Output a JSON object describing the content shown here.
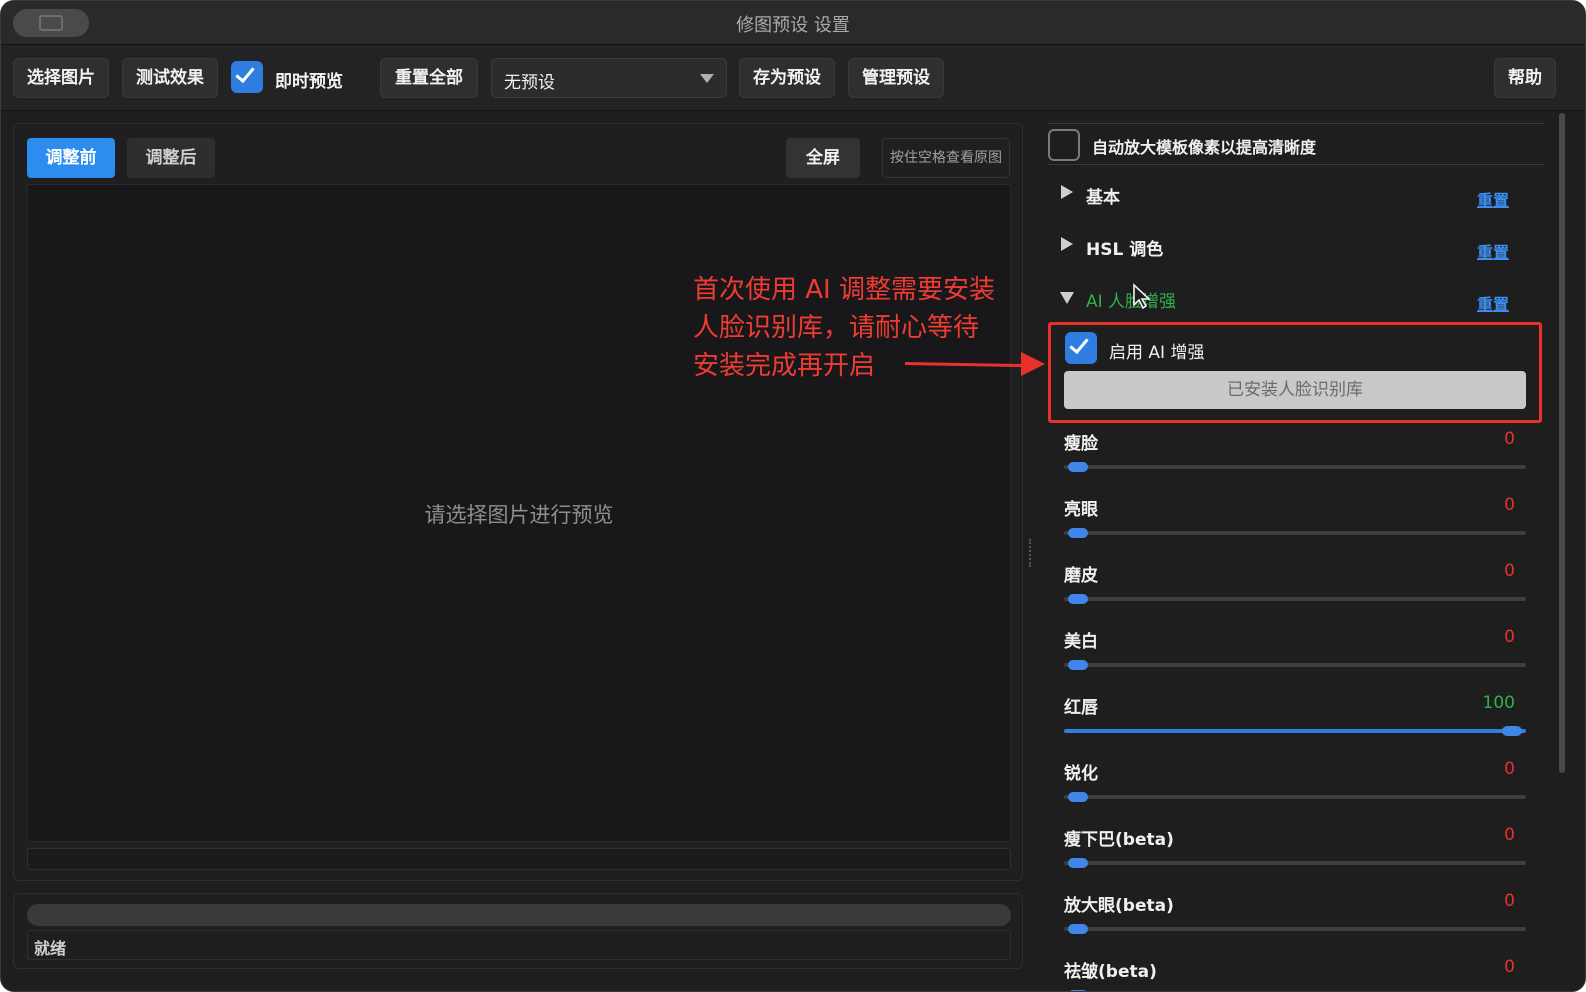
{
  "window": {
    "title": "修图预设 设置"
  },
  "toolbar": {
    "select_image": "选择图片",
    "test_effect": "测试效果",
    "live_preview_label": "即时预览",
    "live_preview_checked": true,
    "reset_all": "重置全部",
    "preset_value": "无预设",
    "save_preset": "存为预设",
    "manage_preset": "管理预设",
    "help": "帮助"
  },
  "preview": {
    "tab_before": "调整前",
    "tab_after": "调整后",
    "fullscreen": "全屏",
    "space_hint": "按住空格查看原图",
    "placeholder": "请选择图片进行预览"
  },
  "status": {
    "text": "就绪"
  },
  "annotation": {
    "lines": [
      "首次使用 AI 调整需要安装",
      "人脸识别库，请耐心等待",
      "安装完成再开启"
    ]
  },
  "settings": {
    "upscale_label": "自动放大模板像素以提高清晰度",
    "upscale_checked": false,
    "sections": [
      {
        "label": "基本",
        "reset": "重置",
        "expanded": false
      },
      {
        "label": "HSL 调色",
        "reset": "重置",
        "expanded": false
      },
      {
        "label": "AI 人脸增强",
        "reset": "重置",
        "expanded": true
      }
    ],
    "ai_enable_label": "启用 AI 增强",
    "ai_enable_checked": true,
    "installed_button": "已安装人脸识别库",
    "sliders": [
      {
        "name": "瘦脸",
        "value": "0",
        "level": 0
      },
      {
        "name": "亮眼",
        "value": "0",
        "level": 0
      },
      {
        "name": "磨皮",
        "value": "0",
        "level": 0
      },
      {
        "name": "美白",
        "value": "0",
        "level": 0
      },
      {
        "name": "红唇",
        "value": "100",
        "level": 1
      },
      {
        "name": "锐化",
        "value": "0",
        "level": 0
      },
      {
        "name": "瘦下巴(beta)",
        "value": "0",
        "level": 0
      },
      {
        "name": "放大眼(beta)",
        "value": "0",
        "level": 0
      },
      {
        "name": "祛皱(beta)",
        "value": "0",
        "level": 0
      }
    ]
  },
  "colors": {
    "accent": "#2d8cf0",
    "zero_value": "#e8312b",
    "nonzero_value": "#2fb14a",
    "annotation": "#ef3b32"
  }
}
